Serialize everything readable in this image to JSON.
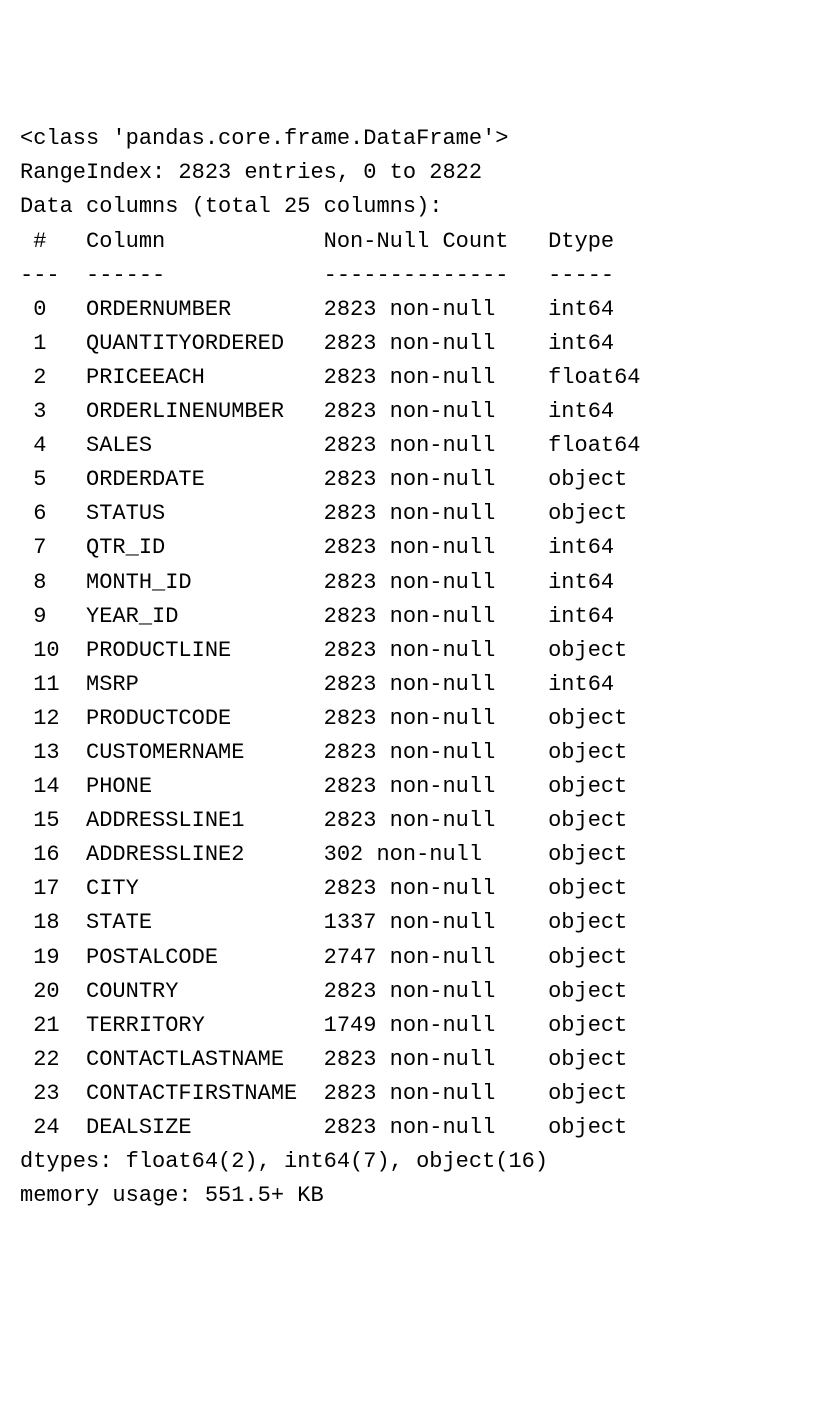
{
  "header": {
    "class_line": "<class 'pandas.core.frame.DataFrame'>",
    "range_index": "RangeIndex: 2823 entries, 0 to 2822",
    "data_columns": "Data columns (total 25 columns):"
  },
  "table_header": {
    "idx": " #",
    "col": "Column",
    "nnc": "Non-Null Count",
    "dtype": "Dtype"
  },
  "divider": {
    "idx": "---",
    "col": "------",
    "nnc": "--------------",
    "dtype": "-----"
  },
  "rows": [
    {
      "idx": " 0",
      "col": "ORDERNUMBER",
      "nnc": "2823 non-null",
      "dtype": "int64"
    },
    {
      "idx": " 1",
      "col": "QUANTITYORDERED",
      "nnc": "2823 non-null",
      "dtype": "int64"
    },
    {
      "idx": " 2",
      "col": "PRICEEACH",
      "nnc": "2823 non-null",
      "dtype": "float64"
    },
    {
      "idx": " 3",
      "col": "ORDERLINENUMBER",
      "nnc": "2823 non-null",
      "dtype": "int64"
    },
    {
      "idx": " 4",
      "col": "SALES",
      "nnc": "2823 non-null",
      "dtype": "float64"
    },
    {
      "idx": " 5",
      "col": "ORDERDATE",
      "nnc": "2823 non-null",
      "dtype": "object"
    },
    {
      "idx": " 6",
      "col": "STATUS",
      "nnc": "2823 non-null",
      "dtype": "object"
    },
    {
      "idx": " 7",
      "col": "QTR_ID",
      "nnc": "2823 non-null",
      "dtype": "int64"
    },
    {
      "idx": " 8",
      "col": "MONTH_ID",
      "nnc": "2823 non-null",
      "dtype": "int64"
    },
    {
      "idx": " 9",
      "col": "YEAR_ID",
      "nnc": "2823 non-null",
      "dtype": "int64"
    },
    {
      "idx": " 10",
      "col": "PRODUCTLINE",
      "nnc": "2823 non-null",
      "dtype": "object"
    },
    {
      "idx": " 11",
      "col": "MSRP",
      "nnc": "2823 non-null",
      "dtype": "int64"
    },
    {
      "idx": " 12",
      "col": "PRODUCTCODE",
      "nnc": "2823 non-null",
      "dtype": "object"
    },
    {
      "idx": " 13",
      "col": "CUSTOMERNAME",
      "nnc": "2823 non-null",
      "dtype": "object"
    },
    {
      "idx": " 14",
      "col": "PHONE",
      "nnc": "2823 non-null",
      "dtype": "object"
    },
    {
      "idx": " 15",
      "col": "ADDRESSLINE1",
      "nnc": "2823 non-null",
      "dtype": "object"
    },
    {
      "idx": " 16",
      "col": "ADDRESSLINE2",
      "nnc": "302 non-null",
      "dtype": "object"
    },
    {
      "idx": " 17",
      "col": "CITY",
      "nnc": "2823 non-null",
      "dtype": "object"
    },
    {
      "idx": " 18",
      "col": "STATE",
      "nnc": "1337 non-null",
      "dtype": "object"
    },
    {
      "idx": " 19",
      "col": "POSTALCODE",
      "nnc": "2747 non-null",
      "dtype": "object"
    },
    {
      "idx": " 20",
      "col": "COUNTRY",
      "nnc": "2823 non-null",
      "dtype": "object"
    },
    {
      "idx": " 21",
      "col": "TERRITORY",
      "nnc": "1749 non-null",
      "dtype": "object"
    },
    {
      "idx": " 22",
      "col": "CONTACTLASTNAME",
      "nnc": "2823 non-null",
      "dtype": "object"
    },
    {
      "idx": " 23",
      "col": "CONTACTFIRSTNAME",
      "nnc": "2823 non-null",
      "dtype": "object"
    },
    {
      "idx": " 24",
      "col": "DEALSIZE",
      "nnc": "2823 non-null",
      "dtype": "object"
    }
  ],
  "footer": {
    "dtypes_line": "dtypes: float64(2), int64(7), object(16)",
    "memory_line": "memory usage: 551.5+ KB"
  }
}
